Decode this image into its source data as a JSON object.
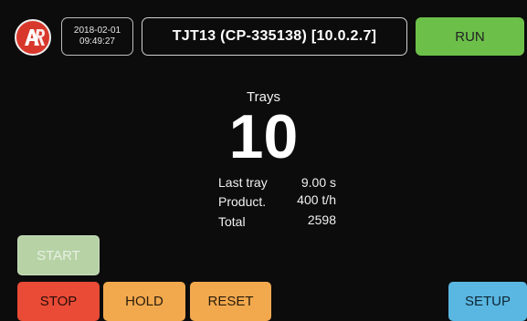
{
  "header": {
    "logo_icon": "ar-logo-icon",
    "date": "2018-02-01",
    "time": "09:49:27",
    "device_title": "TJT13 (CP-335138)  [10.0.2.7]",
    "run_label": "RUN"
  },
  "counter": {
    "label": "Trays",
    "value": "10"
  },
  "stats": {
    "last_tray_label": "Last tray",
    "last_tray_value": "9.00 s",
    "product_label": "Product.",
    "product_value": "400 t/h",
    "total_label": "Total",
    "total_value": "2598"
  },
  "buttons": {
    "start": "START",
    "stop": "STOP",
    "hold": "HOLD",
    "reset": "RESET",
    "setup": "SETUP"
  },
  "colors": {
    "run": "#6cc04a",
    "start_disabled": "#b7d3a6",
    "stop": "#e94b36",
    "hold": "#f2a94e",
    "reset": "#f2a94e",
    "setup": "#5ab7e2",
    "logo": "#d8382c"
  }
}
